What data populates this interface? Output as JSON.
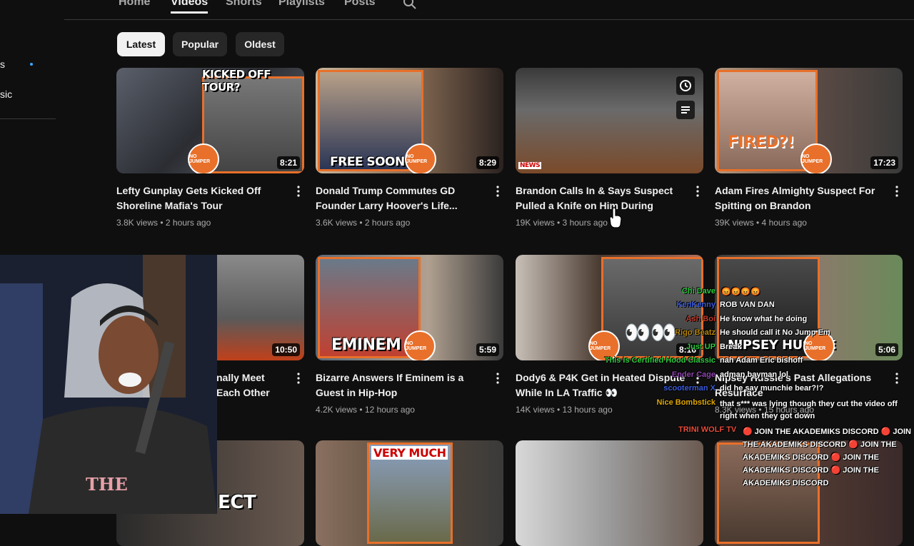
{
  "tabs": [
    {
      "label": "Home"
    },
    {
      "label": "Videos"
    },
    {
      "label": "Shorts"
    },
    {
      "label": "Playlists"
    },
    {
      "label": "Posts"
    }
  ],
  "sidebar_stub": {
    "item1": "s",
    "item2": "sic"
  },
  "filters": [
    {
      "label": "Latest"
    },
    {
      "label": "Popular"
    },
    {
      "label": "Oldest"
    }
  ],
  "videos": [
    {
      "title": "Lefty Gunplay Gets Kicked Off Shoreline Mafia's Tour",
      "meta": "3.8K views • 2 hours ago",
      "duration": "8:21",
      "overlay": "KICKED OFF TOUR?"
    },
    {
      "title": "Donald Trump Commutes GD Founder Larry Hoover's Life...",
      "meta": "3.6K views • 2 hours ago",
      "duration": "8:29",
      "overlay": "FREE SOON?"
    },
    {
      "title": "Brandon Calls In & Says Suspect Pulled a Knife on Him During Their...",
      "meta": "19K views • 3 hours ago",
      "duration": "",
      "overlay": "NEWS"
    },
    {
      "title": "Adam Fires Almighty Suspect For Spitting on Brandon",
      "meta": "39K views • 4 hours ago",
      "duration": "17:23",
      "overlay": "FIRED?!"
    },
    {
      "title": "nally Meet Each Other",
      "meta": "",
      "duration": "10:50",
      "overlay": ""
    },
    {
      "title": "Bizarre Answers If Eminem is a Guest in Hip-Hop",
      "meta": "4.2K views • 12 hours ago",
      "duration": "5:59",
      "overlay": "EMINEM"
    },
    {
      "title": "Dody6 & P4K Get in Heated Dispute While In LA Traffic 👀",
      "meta": "14K views • 13 hours ago",
      "duration": "8:16",
      "overlay": "👀👀"
    },
    {
      "title": "Nipsey Hussle's Past Allegations Resurface",
      "meta": "8.3K views • 15 hours ago",
      "duration": "5:06",
      "overlay": "NIPSEY HUSSLE"
    },
    {
      "title": "",
      "meta": "",
      "duration": "",
      "overlay": "ECT"
    },
    {
      "title": "",
      "meta": "",
      "duration": "",
      "overlay": "VERY MUCH"
    },
    {
      "title": "",
      "meta": "",
      "duration": "",
      "overlay": ""
    },
    {
      "title": "",
      "meta": "",
      "duration": "",
      "overlay": ""
    }
  ],
  "logo_text": "NO JUMPER",
  "chat": [
    {
      "user": "Chi Dave",
      "msg": "😡😡😡😡",
      "user_color": "#2ecc40"
    },
    {
      "user": "KenKenny",
      "msg": "ROB VAN DAN",
      "user_color": "#3b5bdb"
    },
    {
      "user": "Ash Boi",
      "msg": "He know what he doing",
      "user_color": "#c0392b"
    },
    {
      "user": "Rigo Beatz",
      "msg": "He should call it No Jump Em",
      "user_color": "#b8860b"
    },
    {
      "user": "Just UP",
      "msg": "Break",
      "user_color": "#2ecc40"
    },
    {
      "user": "This Is Certified Hood Classic",
      "msg": "nah Adam Eric bishoff",
      "user_color": "#2ecc40"
    },
    {
      "user": "Ender Cage",
      "msg": "adman bayman lol",
      "user_color": "#8e44ad"
    },
    {
      "user": "scooterman X",
      "msg": "did he say munchie bear?!?",
      "user_color": "#3b5bdb"
    },
    {
      "user": "Nice Bombstick",
      "msg": "that s*** was lying though they cut the video off right when they got down",
      "user_color": "#e0a800"
    },
    {
      "user": "TRINI WOLF TV",
      "msg": "🔴 JOIN THE AKADEMIKS DISCORD 🔴 JOIN THE AKADEMIKS DISCORD 🔴 JOIN THE AKADEMIKS DISCORD 🔴 JOIN THE AKADEMIKS DISCORD 🔴 JOIN THE AKADEMIKS DISCORD",
      "user_color": "#e74c3c"
    }
  ],
  "colors": {
    "accent": "#e8702a",
    "bg": "#0f0f0f",
    "chip": "#272727"
  }
}
